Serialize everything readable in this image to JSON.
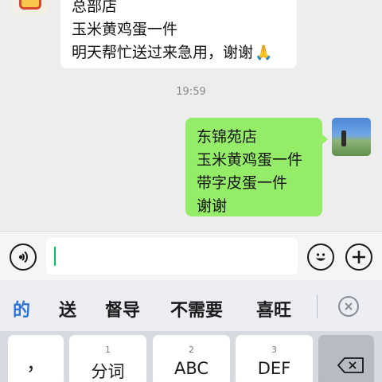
{
  "chat": {
    "messages": [
      {
        "lines": [
          "总部店",
          "玉米黄鸡蛋一件",
          "明天帮忙送过来急用，谢谢"
        ],
        "emoji": "🙏"
      },
      {
        "lines": [
          "东锦苑店",
          "玉米黄鸡蛋一件",
          "带字皮蛋一件",
          "谢谢"
        ]
      }
    ],
    "time": "19:59"
  },
  "input": {
    "value": "",
    "voice_icon": "voice-icon",
    "emoji_icon": "emoji-icon",
    "plus_icon": "plus-icon"
  },
  "suggestions": {
    "items": [
      "的",
      "送",
      "督导",
      "不需要",
      "喜旺"
    ],
    "active_color": "#2a73d8",
    "collapse_icon": "close-circle-icon"
  },
  "keyboard": {
    "keys": [
      {
        "num": "",
        "label": "，"
      },
      {
        "num": "1",
        "label": "分词"
      },
      {
        "num": "2",
        "label": "ABC"
      },
      {
        "num": "3",
        "label": "DEF"
      }
    ],
    "delete_icon": "backspace-icon"
  },
  "colors": {
    "outgoing_bubble": "#95ec69",
    "incoming_bubble": "#ffffff",
    "cursor": "#07c160",
    "background": "#ededed"
  }
}
